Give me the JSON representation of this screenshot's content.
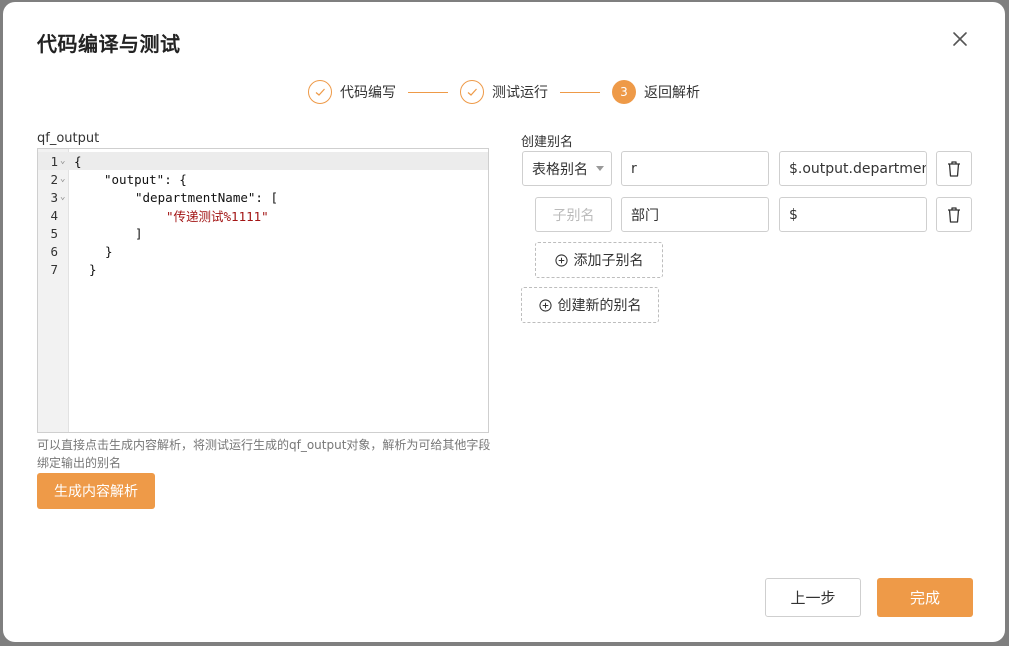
{
  "dialog": {
    "title": "代码编译与测试"
  },
  "steps": [
    {
      "label": "代码编写",
      "state": "done"
    },
    {
      "label": "测试运行",
      "state": "done"
    },
    {
      "label": "返回解析",
      "state": "active",
      "number": "3"
    }
  ],
  "editor": {
    "label": "qf_output",
    "lines": [
      {
        "num": "1",
        "foldable": true
      },
      {
        "num": "2",
        "foldable": true
      },
      {
        "num": "3",
        "foldable": true
      },
      {
        "num": "4",
        "foldable": false
      },
      {
        "num": "5",
        "foldable": false
      },
      {
        "num": "6",
        "foldable": false
      },
      {
        "num": "7",
        "foldable": false
      }
    ],
    "code": {
      "l1": "{",
      "l2_key": "\"output\"",
      "l2_rest": ": {",
      "l3_key": "\"departmentName\"",
      "l3_rest": ": [",
      "l4_val": "\"传递测试%1111\"",
      "l5": "]",
      "l6": "}",
      "l7": "}"
    }
  },
  "hint": "可以直接点击生成内容解析，将测试运行生成的qf_output对象，解析为可给其他字段绑定输出的别名",
  "generate_button": "生成内容解析",
  "alias": {
    "label": "创建别名",
    "row1": {
      "type_select": "表格别名",
      "name": "r",
      "path": "$.output.departmentName"
    },
    "row2": {
      "sub_placeholder": "子别名",
      "name": "部门",
      "path": "$"
    },
    "add_sub_button": "添加子别名",
    "create_new_button": "创建新的别名"
  },
  "footer": {
    "prev_button": "上一步",
    "done_button": "完成"
  },
  "colors": {
    "accent": "#ee9a48"
  }
}
